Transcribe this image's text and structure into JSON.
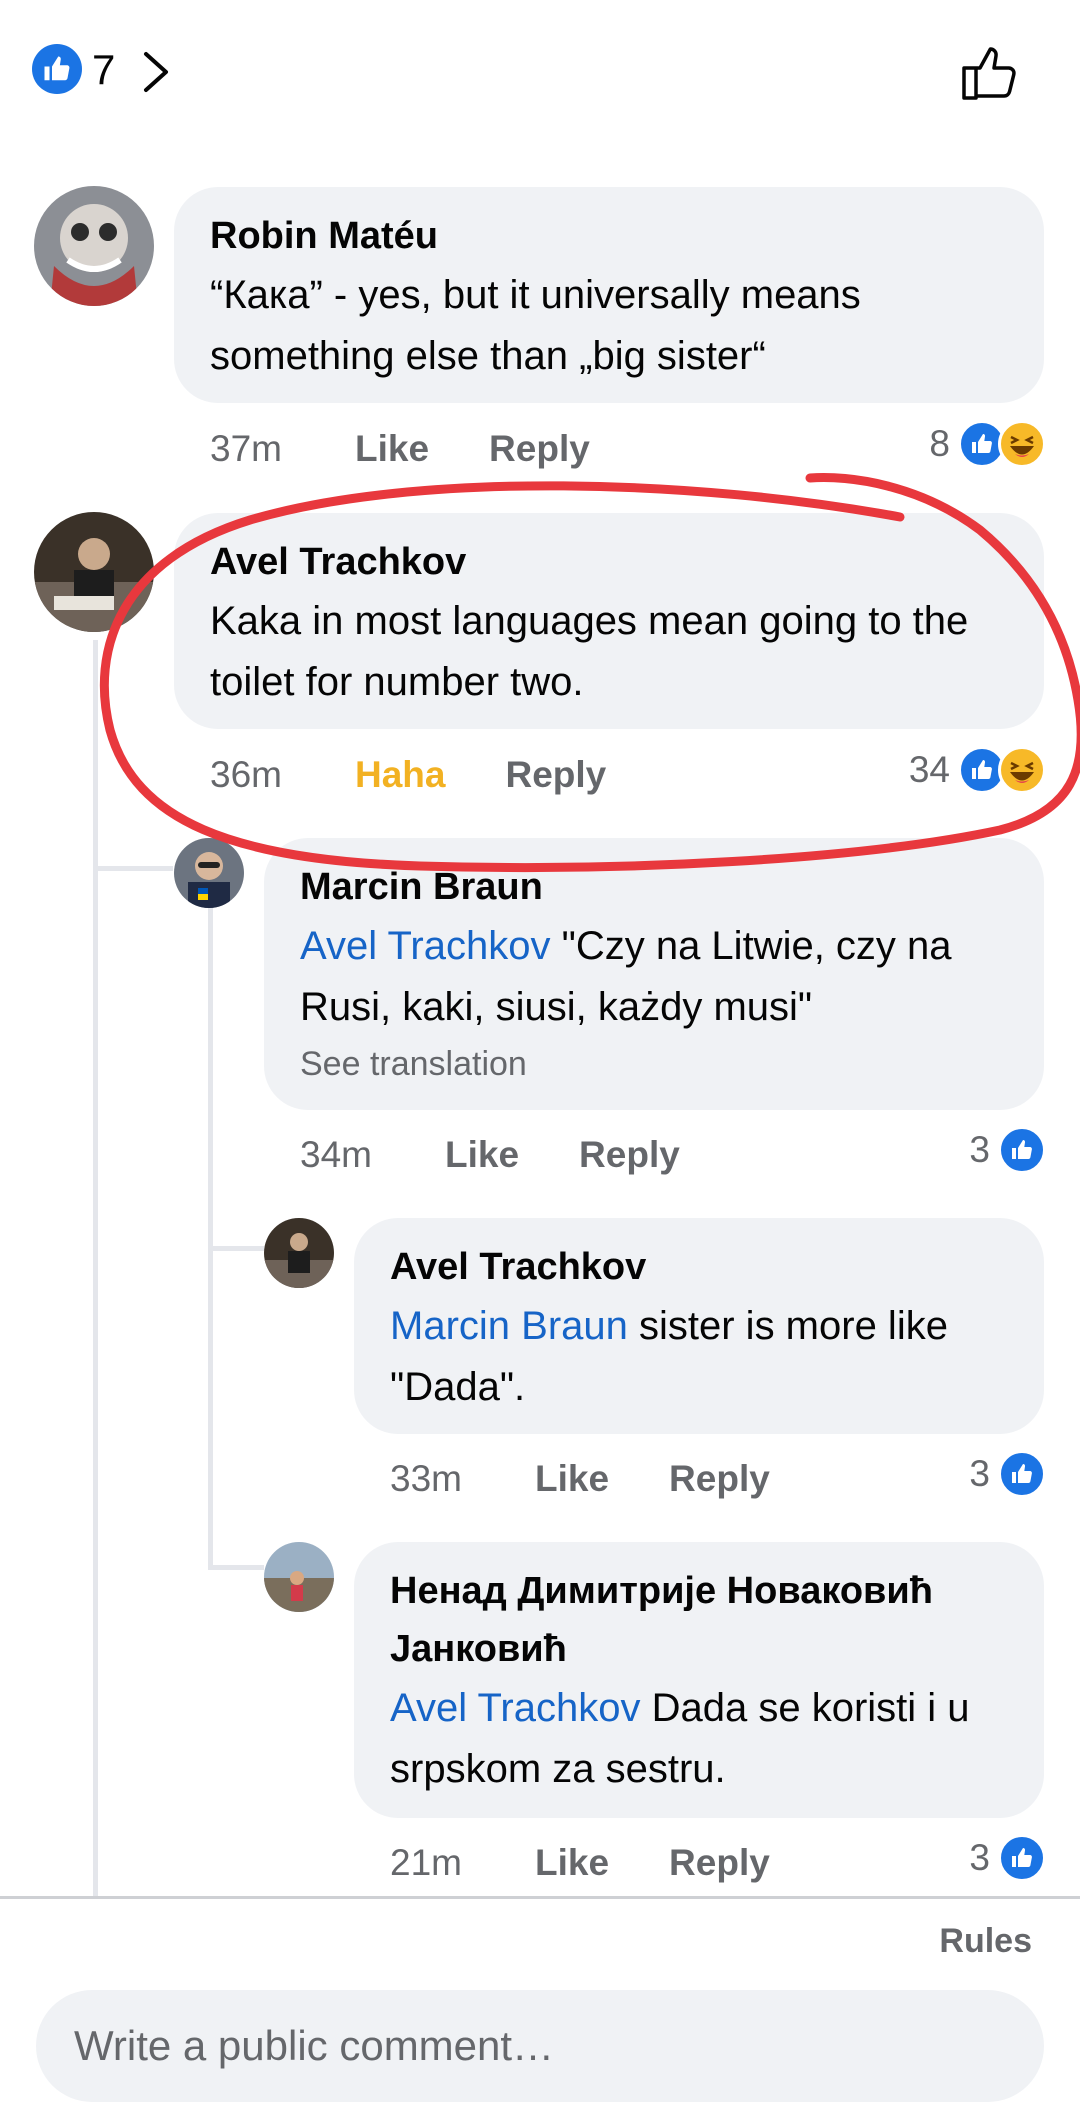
{
  "header": {
    "reaction_count": "7"
  },
  "comments": [
    {
      "author": "Robin Matéu",
      "text": "“Кака” - yes, but it universally means something else than „big sister“",
      "time": "37m",
      "action": "Like",
      "reply": "Reply",
      "reactions": "8",
      "reaction_types": [
        "like-icon",
        "haha-icon"
      ]
    },
    {
      "author": "Avel Trachkov",
      "text": "Kaka in most languages mean going to the toilet for number two.",
      "time": "36m",
      "action": "Haha",
      "reply": "Reply",
      "reactions": "34",
      "reaction_types": [
        "like-icon",
        "haha-icon"
      ]
    },
    {
      "author": "Marcin Braun",
      "mention": "Avel Trachkov",
      "text": "\"Czy na Litwie, czy na Rusi, kaki, siusi, każdy musi\"",
      "see_translation": "See translation",
      "time": "34m",
      "action": "Like",
      "reply": "Reply",
      "reactions": "3",
      "reaction_types": [
        "like-icon"
      ]
    },
    {
      "author": "Avel Trachkov",
      "mention": "Marcin Braun",
      "text": "sister is more like \"Dada\".",
      "time": "33m",
      "action": "Like",
      "reply": "Reply",
      "reactions": "3",
      "reaction_types": [
        "like-icon"
      ]
    },
    {
      "author": "Ненад Димитрије Новаковић Јанковић",
      "mention": "Avel Trachkov",
      "text": "Dada se koristi i u srpskom za sestru.",
      "time": "21m",
      "action": "Like",
      "reply": "Reply",
      "reactions": "3",
      "reaction_types": [
        "like-icon"
      ]
    }
  ],
  "footer": {
    "rules": "Rules",
    "composer_placeholder": "Write a public comment…"
  },
  "colors": {
    "accent": "#1b74e4",
    "mention": "#1664c7",
    "haha_active": "#f2b122",
    "bubble": "#f0f2f5",
    "annotation": "#e8383d"
  }
}
